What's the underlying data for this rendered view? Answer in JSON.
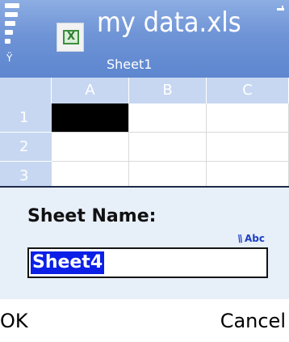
{
  "title_bar": {
    "title": "my data.xls",
    "subtitle": "Sheet1",
    "file_icon": "excel-file-icon",
    "file_icon_glyph": "X",
    "signal_icon": "signal-strength-icon",
    "antenna_glyph": "Ÿ",
    "battery_icon": "battery-icon",
    "colors": {
      "background": "#6f94d6",
      "text": "#ffffff"
    }
  },
  "sheet": {
    "columns": [
      "A",
      "B",
      "C"
    ],
    "rows": [
      "1",
      "2",
      "3"
    ],
    "selected_cell": "A1",
    "colors": {
      "header_background": "#c7d7f1",
      "selected_cell": "#000000"
    }
  },
  "dialog": {
    "label": "Sheet Name:",
    "input_mode": "Abc",
    "input_mode_icon": "pen-input-icon",
    "input_mode_glyph": "\\\\",
    "field_value": "Sheet4",
    "colors": {
      "background": "#e7eff9",
      "selection": "#0c1fe6",
      "input_mode": "#1d3fc2"
    }
  },
  "softkeys": {
    "left": "OK",
    "right": "Cancel"
  }
}
